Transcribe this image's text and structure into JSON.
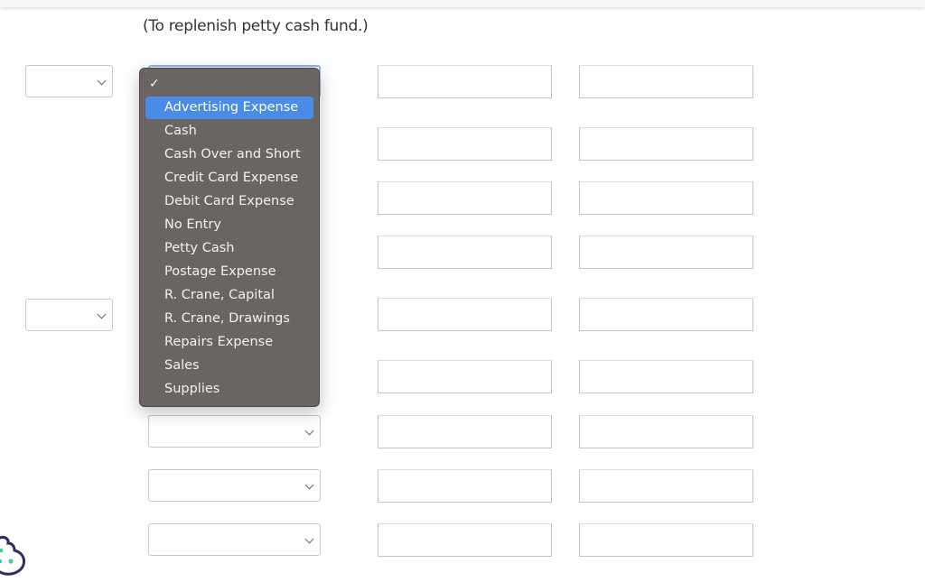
{
  "instruction": "(To replenish petty cash fund.)",
  "dropdown": {
    "selected_check": "✓",
    "options": [
      "Advertising Expense",
      "Cash",
      "Cash Over and Short",
      "Credit Card Expense",
      "Debit Card Expense",
      "No Entry",
      "Petty Cash",
      "Postage Expense",
      "R. Crane, Capital",
      "R. Crane, Drawings",
      "Repairs Expense",
      "Sales",
      "Supplies"
    ],
    "highlighted_index": 0
  },
  "form": {
    "date_selects": [
      "",
      ""
    ],
    "account_selects": [
      "",
      "",
      "",
      ""
    ],
    "debit_inputs": [
      "",
      "",
      "",
      "",
      "",
      "",
      "",
      "",
      ""
    ],
    "credit_inputs": [
      "",
      "",
      "",
      "",
      "",
      "",
      "",
      "",
      ""
    ]
  },
  "colors": {
    "highlight": "#4a8be6",
    "menu_bg": "#6a6462",
    "cookie_outline": "#2e2a6b",
    "cookie_dots": "#3ecf9a"
  }
}
